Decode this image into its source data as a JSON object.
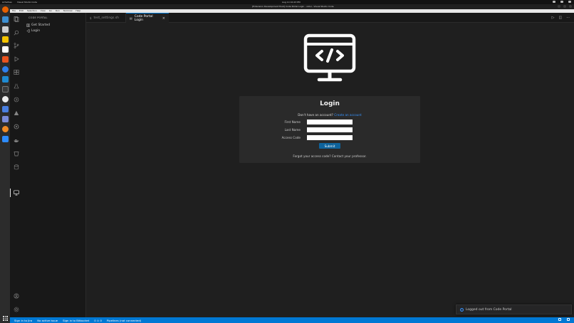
{
  "os_topbar": {
    "activities": "Activities",
    "app_menu": "Visual Studio Code",
    "clock": "Aug 14 10:43 PM"
  },
  "window": {
    "title": "[Extension Development Host] Code Portal Login - ostui - Visual Studio Code"
  },
  "menubar": [
    "File",
    "Edit",
    "Selection",
    "View",
    "Go",
    "Run",
    "Terminal",
    "Help"
  ],
  "sidebar": {
    "title": "CODE PORTAL",
    "items": [
      {
        "label": "Get Started",
        "icon": "book-icon"
      },
      {
        "label": "Login",
        "icon": "login-icon"
      }
    ]
  },
  "tabs": [
    {
      "label": "test_settings.sh",
      "active": false
    },
    {
      "label": "Code Portal Login",
      "active": true
    }
  ],
  "login": {
    "heading": "Login",
    "signup_prompt": "Don't have an account?",
    "signup_link": "Create an account",
    "fields": [
      {
        "label": "First Name",
        "value": ""
      },
      {
        "label": "Last Name",
        "value": ""
      },
      {
        "label": "Access Code",
        "value": ""
      }
    ],
    "submit_label": "Submit",
    "forgot_text": "Forgot your access code? Contact your professor."
  },
  "notification": {
    "message": "Logged out from Code Portal"
  },
  "statusbar": {
    "items": [
      "Sign in to Jira",
      "No active issue",
      "Sign in to Bitbucket",
      "0 ⚠ 0",
      "Pipelines (not connected)"
    ]
  },
  "colors": {
    "accent": "#0078d4",
    "link": "#3794ff",
    "submit": "#0e639c",
    "editor_bg": "#1f1f1f",
    "card_bg": "#2a2a2a"
  }
}
